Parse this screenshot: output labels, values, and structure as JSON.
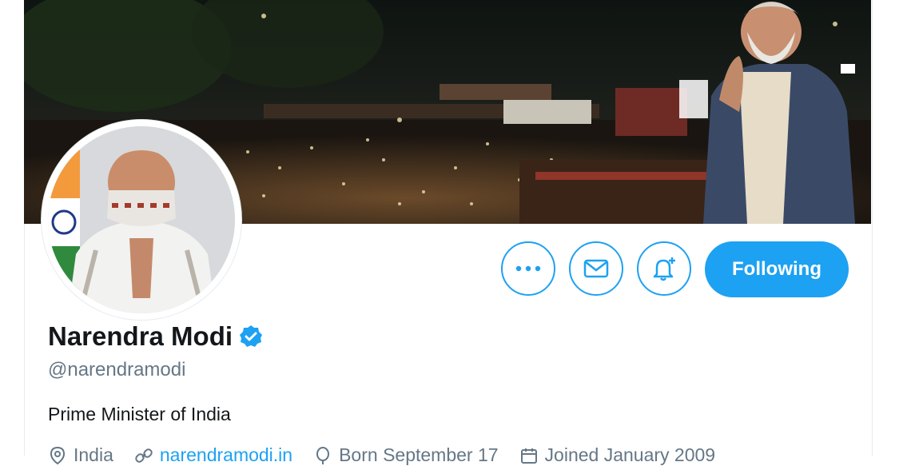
{
  "profile": {
    "name": "Narendra Modi",
    "handle": "@narendramodi",
    "bio": "Prime Minister of India",
    "verified": true
  },
  "actions": {
    "more_icon": "more-icon",
    "message_icon": "envelope-icon",
    "notify_icon": "bell-plus-icon",
    "follow_label": "Following"
  },
  "meta": {
    "location": "India",
    "website": "narendramodi.in",
    "birthday": "Born September 17",
    "joined": "Joined January 2009"
  },
  "colors": {
    "accent": "#1da1f2",
    "secondary_text": "#657786",
    "primary_text": "#14171a"
  }
}
